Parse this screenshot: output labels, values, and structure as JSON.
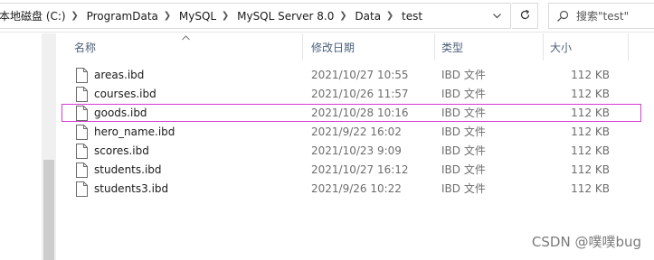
{
  "address_bar": {
    "crumbs": [
      "本地磁盘 (C:)",
      "ProgramData",
      "MySQL",
      "MySQL Server 8.0",
      "Data",
      "test"
    ]
  },
  "search": {
    "placeholder": "搜索\"test\""
  },
  "columns": {
    "name": "名称",
    "modified": "修改日期",
    "type": "类型",
    "size": "大小"
  },
  "files": [
    {
      "name": "areas.ibd",
      "modified": "2021/10/27 10:55",
      "type": "IBD 文件",
      "size": "112 KB"
    },
    {
      "name": "courses.ibd",
      "modified": "2021/10/26 11:57",
      "type": "IBD 文件",
      "size": "112 KB"
    },
    {
      "name": "goods.ibd",
      "modified": "2021/10/28 10:16",
      "type": "IBD 文件",
      "size": "112 KB"
    },
    {
      "name": "hero_name.ibd",
      "modified": "2021/9/22 16:02",
      "type": "IBD 文件",
      "size": "112 KB"
    },
    {
      "name": "scores.ibd",
      "modified": "2021/10/23 9:09",
      "type": "IBD 文件",
      "size": "112 KB"
    },
    {
      "name": "students.ibd",
      "modified": "2021/10/27 16:12",
      "type": "IBD 文件",
      "size": "112 KB"
    },
    {
      "name": "students3.ibd",
      "modified": "2021/9/26 10:22",
      "type": "IBD 文件",
      "size": "112 KB"
    }
  ],
  "highlighted_file": "goods.ibd",
  "highlight_color": "#d63bd6",
  "watermark": "CSDN @噗噗bug"
}
